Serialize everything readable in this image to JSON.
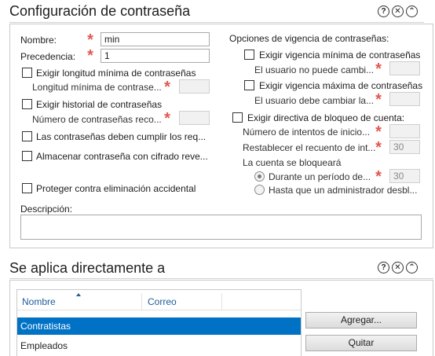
{
  "password_config": {
    "title": "Configuración de contraseña",
    "name_label": "Nombre:",
    "name_value": "min",
    "precedence_label": "Precedencia:",
    "precedence_value": "1",
    "enforce_min_length": "Exigir longitud mínima de contraseñas",
    "min_length_label": "Longitud mínima de contrase...",
    "enforce_history": "Exigir historial de contraseñas",
    "history_count_label": "Número de contraseñas reco...",
    "complexity": "Las contraseñas deben cumplir los req...",
    "reversible": "Almacenar contraseña con cifrado reve...",
    "protect_deletion": "Proteger contra eliminación accidental",
    "description_label": "Descripción:",
    "expiration_header": "Opciones de vigencia de contraseñas:",
    "enforce_min_age": "Exigir vigencia mínima de contraseñas",
    "min_age_sub": "El usuario no puede cambi...",
    "enforce_max_age": "Exigir vigencia máxima de contraseñas",
    "max_age_sub": "El usuario debe cambiar la...",
    "enforce_lockout": "Exigir directiva de bloqueo de cuenta:",
    "failed_attempts": "Número de intentos de inicio...",
    "reset_count": "Restablecer el recuento de int...",
    "reset_count_value": "30",
    "locked_label": "La cuenta se bloqueará",
    "duration_radio": "Durante un período de...",
    "duration_value": "30",
    "until_admin_radio": "Hasta que un administrador desbl..."
  },
  "applies_to": {
    "title": "Se aplica directamente a",
    "col_name": "Nombre",
    "col_email": "Correo",
    "rows": [
      {
        "name": "Contratistas",
        "email": "",
        "selected": true
      },
      {
        "name": "Empleados",
        "email": "",
        "selected": false
      }
    ],
    "add_button": "Agregar...",
    "remove_button": "Quitar"
  },
  "icons": {
    "help": "?",
    "collapse": "⌃",
    "close": "✕"
  },
  "colors": {
    "required": "#e3574f",
    "selected_row": "#0072c6",
    "column_header": "#1f5c99"
  }
}
